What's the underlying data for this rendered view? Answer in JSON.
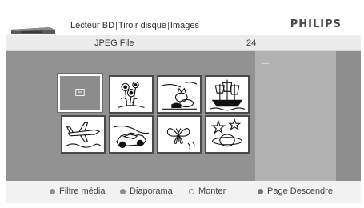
{
  "header": {
    "breadcrumb": [
      "Lecteur BD",
      "Tiroir disque",
      "Images"
    ],
    "brand": "PHILIPS"
  },
  "subheader": {
    "folder_name": "JPEG File",
    "item_count": "24"
  },
  "info_panel": {
    "text": "---"
  },
  "thumbnails": [
    {
      "icon": "folder-icon",
      "selected": true
    },
    {
      "icon": "flowers-icon",
      "selected": false
    },
    {
      "icon": "cat-icon",
      "selected": false
    },
    {
      "icon": "sailing-ship-icon",
      "selected": false
    },
    {
      "icon": "airplane-icon",
      "selected": false
    },
    {
      "icon": "car-icon",
      "selected": false
    },
    {
      "icon": "butterfly-icon",
      "selected": false
    },
    {
      "icon": "planets-icon",
      "selected": false
    }
  ],
  "footer": {
    "filter_label": "Filtre média",
    "slideshow_label": "Diaporama",
    "up_label": "Monter",
    "page_down_label": "Page Descendre"
  },
  "colors": {
    "grid_background": "#929292",
    "info_panel_background": "#b1b1b1",
    "selected_border": "#ffffff"
  }
}
